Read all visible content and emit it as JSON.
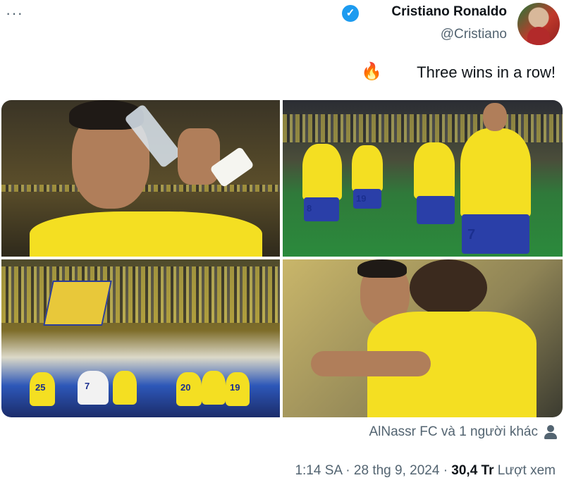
{
  "header": {
    "more_label": "···",
    "display_name": "Cristiano Ronaldo",
    "handle": "@Cristiano",
    "verified_glyph": "✓"
  },
  "tweet": {
    "text": "Three wins in a row!",
    "emoji": "🔥"
  },
  "media": {
    "photo_count": 4,
    "jersey_numbers": [
      "8",
      "19",
      "7",
      "25",
      "20",
      "19",
      "7"
    ]
  },
  "footer": {
    "mention_text": "AlNassr FC và 1 người khác",
    "time": "1:14 SA",
    "date": "28 thg 9, 2024",
    "views_count": "30,4 Tr",
    "views_label": "Lượt xem",
    "separator": "·"
  },
  "colors": {
    "accent": "#1d9bf0",
    "secondary_text": "#536471",
    "primary_text": "#0f1419",
    "jersey_yellow": "#f4df22",
    "shorts_blue": "#2a3fa8"
  },
  "icons": [
    "more-icon",
    "verified-badge-icon",
    "fire-emoji",
    "person-icon"
  ]
}
